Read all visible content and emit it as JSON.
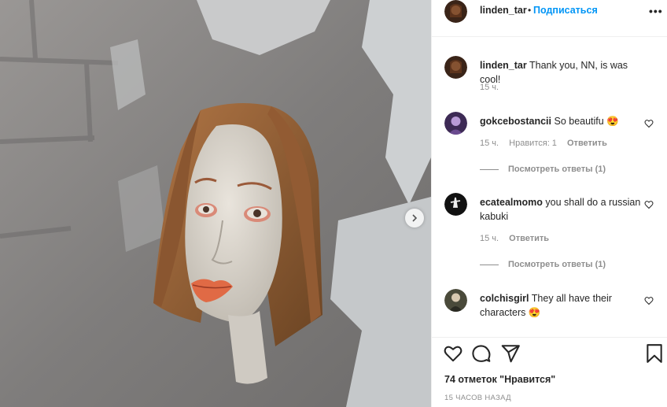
{
  "header": {
    "username": "linden_tar",
    "separator": "•",
    "follow_label": "Подписаться",
    "more_label": "•••"
  },
  "comments": [
    {
      "username": "linden_tar",
      "text": "Thank you, NN, is was cool!",
      "time": "15 ч.",
      "likes": "",
      "reply": ""
    },
    {
      "username": "gokcebostancii",
      "text": "So beautifu 😍",
      "time": "15 ч.",
      "likes": "Нравится: 1",
      "reply": "Ответить",
      "view_replies": "Посмотреть ответы (1)"
    },
    {
      "username": "ecatealmomo",
      "text": "you shall do a russian kabuki",
      "time": "15 ч.",
      "likes": "",
      "reply": "Ответить",
      "view_replies": "Посмотреть ответы (1)"
    },
    {
      "username": "colchisgirl",
      "text": "They all have their characters 😍",
      "time": "",
      "likes": "",
      "reply": ""
    }
  ],
  "likes_text": "74 отметок \"Нравится\"",
  "timestamp": "15 ЧАСОВ НАЗАД",
  "icons": {
    "like": "heart-icon",
    "comment": "comment-icon",
    "share": "share-icon",
    "save": "bookmark-icon",
    "next": "chevron-right-icon"
  },
  "colors": {
    "link": "#0095f6",
    "text": "#262626",
    "muted": "#8e8e8e"
  }
}
